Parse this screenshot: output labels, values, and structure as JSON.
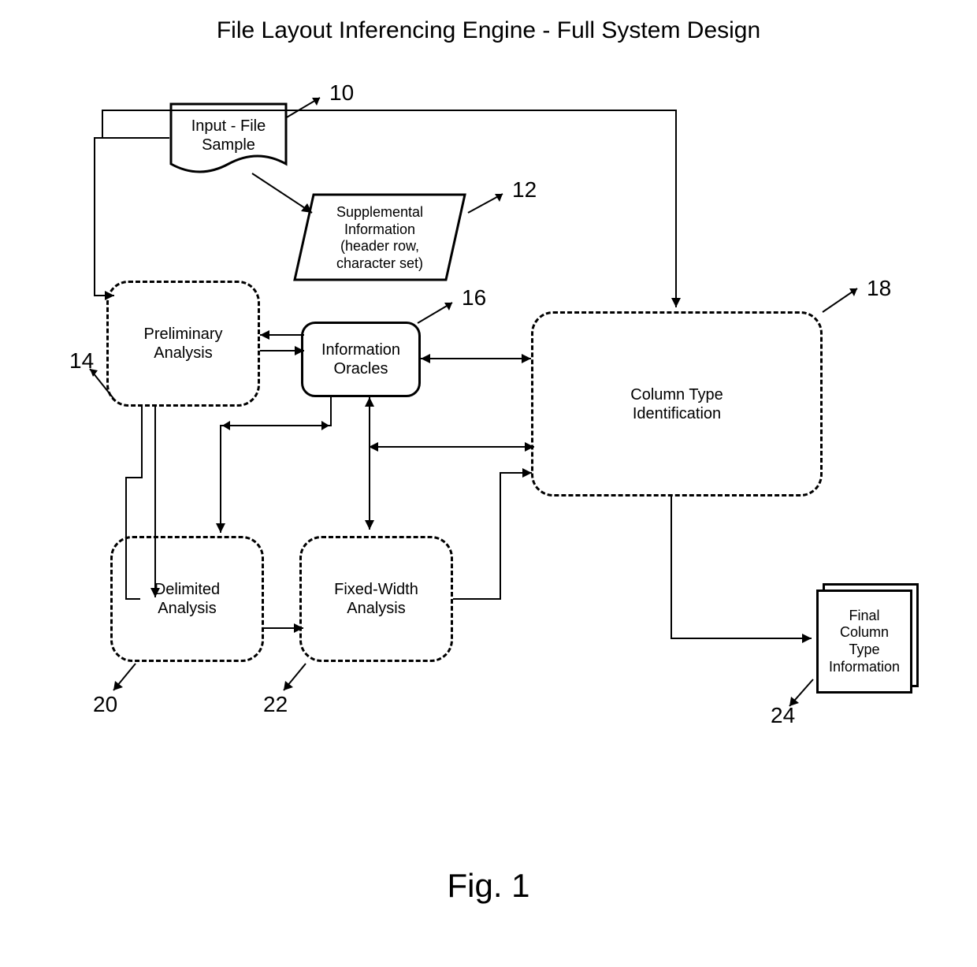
{
  "title": "File Layout Inferencing Engine - Full System Design",
  "caption": "Fig. 1",
  "nodes": {
    "input_file_sample": {
      "label": "Input - File\nSample",
      "ref": "10"
    },
    "supplemental_info": {
      "label": "Supplemental\nInformation\n(header row,\ncharacter set)",
      "ref": "12"
    },
    "preliminary_analysis": {
      "label": "Preliminary\nAnalysis",
      "ref": "14"
    },
    "information_oracles": {
      "label": "Information\nOracles",
      "ref": "16"
    },
    "column_type_identification": {
      "label": "Column Type\nIdentification",
      "ref": "18"
    },
    "delimited_analysis": {
      "label": "Delimited\nAnalysis",
      "ref": "20"
    },
    "fixed_width_analysis": {
      "label": "Fixed-Width\nAnalysis",
      "ref": "22"
    },
    "final_output": {
      "label": "Final\nColumn\nType\nInformation",
      "ref": "24"
    }
  }
}
